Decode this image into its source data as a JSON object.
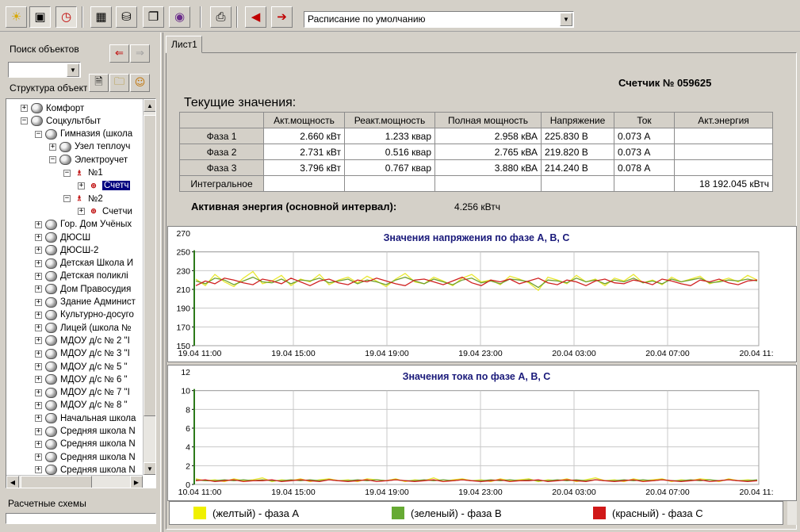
{
  "toolbar": {
    "buttons": [
      "sun-icon",
      "objects-icon",
      "clock-icon",
      "calculator-icon",
      "database-icon",
      "documents-icon",
      "cd-icon",
      "printer-icon",
      "arrow-left-icon",
      "exit-icon"
    ],
    "schedule_value": "Расписание по умолчанию"
  },
  "left": {
    "search_label": "Поиск объектов",
    "structure_label": "Структура объектов",
    "schemes_label": "Расчетные схемы",
    "tree": [
      {
        "level": 1,
        "pm": "+",
        "label": "Комфорт"
      },
      {
        "level": 1,
        "pm": "−",
        "label": "Соцкультбыт"
      },
      {
        "level": 2,
        "pm": "−",
        "label": "Гимназия (школа"
      },
      {
        "level": 3,
        "pm": "+",
        "label": "Узел теплоуч"
      },
      {
        "level": 3,
        "pm": "−",
        "label": "Электроучет"
      },
      {
        "level": 4,
        "pm": "−",
        "label": "№1"
      },
      {
        "level": 5,
        "pm": "+",
        "label": "Счетч",
        "selected": true
      },
      {
        "level": 4,
        "pm": "−",
        "label": "№2"
      },
      {
        "level": 5,
        "pm": "+",
        "label": "Счетчи"
      },
      {
        "level": 2,
        "pm": "+",
        "label": "Гор. Дом Учёных"
      },
      {
        "level": 2,
        "pm": "+",
        "label": "ДЮСШ"
      },
      {
        "level": 2,
        "pm": "+",
        "label": "ДЮСШ-2"
      },
      {
        "level": 2,
        "pm": "+",
        "label": "Детская Школа И"
      },
      {
        "level": 2,
        "pm": "+",
        "label": "Детская поликлі"
      },
      {
        "level": 2,
        "pm": "+",
        "label": "Дом Правосудия"
      },
      {
        "level": 2,
        "pm": "+",
        "label": "Здание Админист"
      },
      {
        "level": 2,
        "pm": "+",
        "label": "Культурно-досуго"
      },
      {
        "level": 2,
        "pm": "+",
        "label": "Лицей (школа №"
      },
      {
        "level": 2,
        "pm": "+",
        "label": "МДОУ д/с № 2 \"I"
      },
      {
        "level": 2,
        "pm": "+",
        "label": "МДОУ д/с № 3 \"I"
      },
      {
        "level": 2,
        "pm": "+",
        "label": "МДОУ д/с № 5 \""
      },
      {
        "level": 2,
        "pm": "+",
        "label": "МДОУ д/с № 6 \""
      },
      {
        "level": 2,
        "pm": "+",
        "label": "МДОУ д/с № 7 \"I"
      },
      {
        "level": 2,
        "pm": "+",
        "label": "МДОУ д/с № 8 \""
      },
      {
        "level": 2,
        "pm": "+",
        "label": "Начальная школа"
      },
      {
        "level": 2,
        "pm": "+",
        "label": "Средняя школа N"
      },
      {
        "level": 2,
        "pm": "+",
        "label": "Средняя школа N"
      },
      {
        "level": 2,
        "pm": "+",
        "label": "Средняя школа N"
      },
      {
        "level": 2,
        "pm": "+",
        "label": "Средняя школа N"
      }
    ]
  },
  "tab_label": "Лист1",
  "report": {
    "meter_title": "Счетчик № 059625",
    "current_title": "Текущие значения:",
    "headers": [
      "",
      "Акт.мощность",
      "Реакт.мощность",
      "Полная мощность",
      "Напряжение",
      "Ток",
      "Акт.энергия"
    ],
    "rows": [
      [
        "Фаза 1",
        "2.660 кВт",
        "1.233 квар",
        "2.958 кВА",
        "225.830 В",
        "0.073 А",
        ""
      ],
      [
        "Фаза 2",
        "2.731 кВт",
        "0.516 квар",
        "2.765 кВА",
        "219.820 В",
        "0.073 А",
        ""
      ],
      [
        "Фаза 3",
        "3.796 кВт",
        "0.767 квар",
        "3.880 кВА",
        "214.240 В",
        "0.078 А",
        ""
      ],
      [
        "Интегральное",
        "",
        "",
        "",
        "",
        "",
        "18 192.045 кВтч"
      ]
    ],
    "energy_label": "Активная энергия (основной интервал):",
    "energy_value": "4.256 кВтч"
  },
  "colors": {
    "phase_a": "#e8e830",
    "phase_b": "#70a030",
    "phase_c": "#d02020",
    "title": "#1a1a7a"
  },
  "legend": [
    {
      "label": "(желтый) - фаза А",
      "color": "#f0f000"
    },
    {
      "label": "(зеленый) - фаза В",
      "color": "#66aa33"
    },
    {
      "label": "(красный) - фаза С",
      "color": "#d01818"
    }
  ],
  "chart_data": [
    {
      "type": "line",
      "title": "Значения напряжения по фазе А, В, С",
      "ylim": [
        150,
        270
      ],
      "yticks": [
        "270",
        "250",
        "230",
        "210",
        "190",
        "170",
        "150"
      ],
      "xticks": [
        "19.04 11:00",
        "19.04 15:00",
        "19.04 19:00",
        "19.04 23:00",
        "20.04 03:00",
        "20.04 07:00",
        "20.04 11:"
      ],
      "series": [
        {
          "name": "фаза А",
          "values": [
            221,
            214,
            226,
            218,
            213,
            222,
            229,
            216,
            219,
            225,
            214,
            221,
            218,
            226,
            215,
            220,
            223,
            217,
            224,
            219,
            213,
            221,
            227,
            218,
            216,
            223,
            219,
            214,
            222,
            226,
            218,
            220,
            215,
            224,
            221,
            217,
            209,
            223,
            220,
            216,
            225,
            218,
            221,
            214,
            222,
            219,
            226,
            217,
            220,
            215,
            223,
            218,
            221,
            224,
            216,
            219,
            222,
            218,
            225,
            220
          ]
        },
        {
          "name": "фаза В",
          "values": [
            219,
            216,
            222,
            220,
            215,
            219,
            223,
            218,
            217,
            221,
            216,
            220,
            219,
            222,
            217,
            219,
            221,
            216,
            220,
            218,
            215,
            220,
            223,
            219,
            216,
            221,
            218,
            215,
            220,
            222,
            217,
            219,
            216,
            221,
            220,
            218,
            212,
            220,
            219,
            217,
            222,
            218,
            220,
            216,
            220,
            218,
            222,
            217,
            219,
            216,
            221,
            218,
            220,
            222,
            217,
            218,
            220,
            219,
            221,
            219
          ]
        },
        {
          "name": "фаза С",
          "values": [
            214,
            219,
            216,
            222,
            220,
            217,
            215,
            221,
            219,
            216,
            222,
            218,
            214,
            219,
            221,
            217,
            215,
            220,
            218,
            222,
            219,
            216,
            214,
            220,
            221,
            218,
            215,
            219,
            223,
            217,
            214,
            220,
            218,
            221,
            216,
            219,
            222,
            217,
            215,
            220,
            218,
            214,
            219,
            221,
            217,
            216,
            220,
            218,
            215,
            221,
            219,
            216,
            214,
            220,
            218,
            221,
            217,
            215,
            219,
            220
          ]
        }
      ]
    },
    {
      "type": "line",
      "title": "Значения тока по фазе А, В, С",
      "ylim": [
        0,
        12
      ],
      "yticks": [
        "12",
        "10",
        "8",
        "6",
        "4",
        "2",
        "0"
      ],
      "xticks": [
        "10.04 11:00",
        "19.04 15:00",
        "19.04 19:00",
        "19.04 23:00",
        "20.04 03:00",
        "20.04 07:00",
        "20.04 11:"
      ],
      "series": [
        {
          "name": "фаза А",
          "values": [
            0.6,
            0.4,
            0.5,
            0.3,
            0.6,
            0.4,
            0.5,
            0.7,
            0.3,
            0.5,
            0.4,
            0.6,
            0.3,
            0.5,
            0.6,
            0.4,
            0.5,
            0.3,
            0.6,
            0.5,
            0.4,
            0.6,
            0.3,
            0.5,
            0.4,
            0.7,
            0.3,
            0.5,
            0.6,
            0.4,
            0.5,
            0.3,
            0.6,
            0.4,
            0.5,
            0.6,
            0.3,
            0.5,
            0.4,
            0.6,
            0.3,
            0.5,
            0.7,
            0.4,
            0.5,
            0.3,
            0.6,
            0.4,
            0.5,
            0.6,
            0.3,
            0.5,
            0.4,
            0.6,
            0.5,
            0.3,
            0.6,
            0.4,
            0.5,
            0.4
          ]
        },
        {
          "name": "фаза В",
          "values": [
            0.5,
            0.4,
            0.4,
            0.5,
            0.4,
            0.5,
            0.4,
            0.5,
            0.4,
            0.4,
            0.5,
            0.4,
            0.5,
            0.4,
            0.5,
            0.4,
            0.4,
            0.5,
            0.4,
            0.5,
            0.4,
            0.5,
            0.4,
            0.4,
            0.5,
            0.4,
            0.5,
            0.4,
            0.5,
            0.4,
            0.4,
            0.5,
            0.4,
            0.5,
            0.4,
            0.5,
            0.4,
            0.4,
            0.5,
            0.4,
            0.5,
            0.4,
            0.5,
            0.4,
            0.4,
            0.5,
            0.4,
            0.5,
            0.4,
            0.5,
            0.4,
            0.4,
            0.5,
            0.4,
            0.5,
            0.4,
            0.5,
            0.4,
            0.4,
            0.5
          ]
        },
        {
          "name": "фаза С",
          "values": [
            0.4,
            0.5,
            0.3,
            0.4,
            0.5,
            0.3,
            0.4,
            0.4,
            0.5,
            0.3,
            0.4,
            0.5,
            0.4,
            0.3,
            0.5,
            0.4,
            0.3,
            0.4,
            0.5,
            0.3,
            0.4,
            0.5,
            0.4,
            0.3,
            0.4,
            0.5,
            0.3,
            0.4,
            0.5,
            0.4,
            0.3,
            0.4,
            0.5,
            0.3,
            0.4,
            0.4,
            0.5,
            0.3,
            0.4,
            0.5,
            0.4,
            0.3,
            0.5,
            0.4,
            0.3,
            0.4,
            0.5,
            0.3,
            0.4,
            0.5,
            0.4,
            0.3,
            0.4,
            0.5,
            0.3,
            0.4,
            0.5,
            0.4,
            0.3,
            0.4
          ]
        }
      ]
    }
  ]
}
